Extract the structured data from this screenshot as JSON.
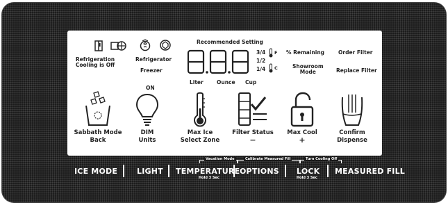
{
  "display": {
    "recommended_setting": "Recommended Setting",
    "refrigeration_off": "Refrigeration\nCooling is Off",
    "refrigerator": "Refrigerator",
    "freezer": "Freezer",
    "digits": "8.8.8",
    "frac_3_4": "3/4",
    "frac_1_2": "1/2",
    "frac_1_4": "1/4",
    "unit_f": "F",
    "unit_c": "C",
    "liter": "Liter",
    "ounce": "Ounce",
    "cup": "Cup",
    "pct_remaining": "% Remaining",
    "showroom_mode": "Showroom\nMode",
    "order_filter": "Order Filter",
    "replace_filter": "Replace Filter",
    "on": "ON"
  },
  "functions": [
    {
      "line1": "Sabbath Mode",
      "line2": "Back",
      "icon": "ice-bucket-icon"
    },
    {
      "line1": "DIM",
      "line2": "Units",
      "icon": "light-bulb-icon"
    },
    {
      "line1": "Max Ice",
      "line2": "Select Zone",
      "icon": "thermometer-icon"
    },
    {
      "line1": "Filter Status",
      "line2": "−",
      "icon": "filter-status-icon"
    },
    {
      "line1": "Max Cool",
      "line2": "+",
      "icon": "padlock-icon"
    },
    {
      "line1": "Confirm",
      "line2": "Dispense",
      "icon": "glass-icon"
    }
  ],
  "buttons": {
    "ice_mode": "ICE MODE",
    "light": "LIGHT",
    "temperature": "TEMPERATURE",
    "temperature_hold": "Hold 3 Sec",
    "options": "OPTIONS",
    "lock": "LOCK",
    "lock_hold": "Hold 3 Sec",
    "measured_fill": "MEASURED FILL"
  },
  "combos": {
    "vacation_mode": "Vacation Mode",
    "calibrate_fill": "Calibrate Measured Fill",
    "turn_cooling_off": "Turn Cooling Off"
  },
  "colors": {
    "panel": "#1b1b1b",
    "display": "#ffffff",
    "text": "#222222"
  }
}
